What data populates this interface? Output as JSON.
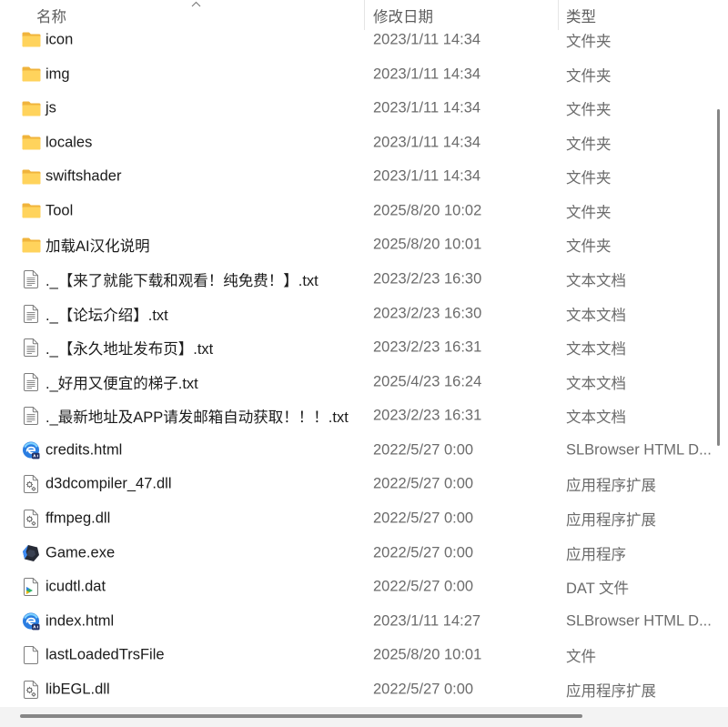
{
  "header": {
    "name_label": "名称",
    "modified_label": "修改日期",
    "type_label": "类型",
    "sort_icon": "chevron-up-icon"
  },
  "files": [
    {
      "icon": "folder-icon",
      "name": "icon",
      "modified": "2023/1/11 14:34",
      "type": "文件夹"
    },
    {
      "icon": "folder-icon",
      "name": "img",
      "modified": "2023/1/11 14:34",
      "type": "文件夹"
    },
    {
      "icon": "folder-icon",
      "name": "js",
      "modified": "2023/1/11 14:34",
      "type": "文件夹"
    },
    {
      "icon": "folder-icon",
      "name": "locales",
      "modified": "2023/1/11 14:34",
      "type": "文件夹"
    },
    {
      "icon": "folder-icon",
      "name": "swiftshader",
      "modified": "2023/1/11 14:34",
      "type": "文件夹"
    },
    {
      "icon": "folder-icon",
      "name": "Tool",
      "modified": "2025/8/20 10:02",
      "type": "文件夹"
    },
    {
      "icon": "folder-icon",
      "name": "加载AI汉化说明",
      "modified": "2025/8/20 10:01",
      "type": "文件夹"
    },
    {
      "icon": "text-document-icon",
      "name": "._【来了就能下载和观看！纯免费！】.txt",
      "modified": "2023/2/23 16:30",
      "type": "文本文档"
    },
    {
      "icon": "text-document-icon",
      "name": "._【论坛介绍】.txt",
      "modified": "2023/2/23 16:30",
      "type": "文本文档"
    },
    {
      "icon": "text-document-icon",
      "name": "._【永久地址发布页】.txt",
      "modified": "2023/2/23 16:31",
      "type": "文本文档"
    },
    {
      "icon": "text-document-icon",
      "name": "._好用又便宜的梯子.txt",
      "modified": "2025/4/23 16:24",
      "type": "文本文档"
    },
    {
      "icon": "text-document-icon",
      "name": "._最新地址及APP请发邮箱自动获取！！！.txt",
      "modified": "2023/2/23 16:31",
      "type": "文本文档"
    },
    {
      "icon": "slbrowser-icon",
      "name": "credits.html",
      "modified": "2022/5/27 0:00",
      "type": "SLBrowser HTML D..."
    },
    {
      "icon": "dll-file-icon",
      "name": "d3dcompiler_47.dll",
      "modified": "2022/5/27 0:00",
      "type": "应用程序扩展"
    },
    {
      "icon": "dll-file-icon",
      "name": "ffmpeg.dll",
      "modified": "2022/5/27 0:00",
      "type": "应用程序扩展"
    },
    {
      "icon": "game-exe-icon",
      "name": "Game.exe",
      "modified": "2022/5/27 0:00",
      "type": "应用程序"
    },
    {
      "icon": "dat-file-icon",
      "name": "icudtl.dat",
      "modified": "2022/5/27 0:00",
      "type": "DAT 文件"
    },
    {
      "icon": "slbrowser-icon",
      "name": "index.html",
      "modified": "2023/1/11 14:27",
      "type": "SLBrowser HTML D..."
    },
    {
      "icon": "blank-file-icon",
      "name": "lastLoadedTrsFile",
      "modified": "2025/8/20 10:01",
      "type": "文件"
    },
    {
      "icon": "dll-file-icon",
      "name": "libEGL.dll",
      "modified": "2022/5/27 0:00",
      "type": "应用程序扩展"
    }
  ],
  "colors": {
    "name_text": "#1b1b1b",
    "detail_text": "#6b6b6b",
    "header_text": "#5e5e5e",
    "folder_front": "#FFD35C",
    "folder_back": "#F0B43C",
    "scrollbar_thumb": "#868686",
    "scrollbar_track": "#f3f3f3"
  }
}
